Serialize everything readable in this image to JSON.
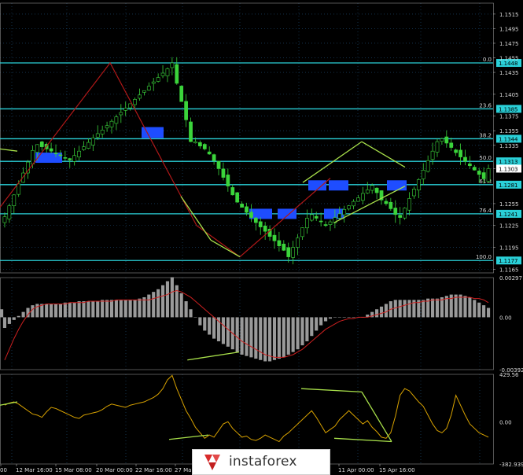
{
  "colors": {
    "background": "#000000",
    "grid": "#1f4f7a",
    "axis_text": "#d9d9d9",
    "candle": "#3bd43b",
    "fib_level": "#2ad0d8",
    "fib_label_bg": "#2ad0d8",
    "trend_line": "#a8e04a",
    "red_line": "#b01818",
    "zone": "#1e4dff",
    "histogram": "#9a9a9a",
    "signal": "#cc2020",
    "oscillator": "#d8a200"
  },
  "chart_data": [
    {
      "type": "candlestick",
      "name": "price",
      "ylim": [
        1.116,
        1.153
      ],
      "price_ticks": [
        "1.1515",
        "1.1495",
        "1.1475",
        "1.1455",
        "1.1435",
        "1.1405",
        "1.1375",
        "1.1355",
        "1.1335",
        "1.1303",
        "1.1255",
        "1.1225",
        "1.1195",
        "1.1165"
      ],
      "price_tick_values": [
        1.1515,
        1.1495,
        1.1475,
        1.1455,
        1.1435,
        1.1405,
        1.1375,
        1.1355,
        1.1335,
        1.1303,
        1.1255,
        1.1225,
        1.1195,
        1.1165
      ],
      "fib_levels": [
        {
          "label": "0.0",
          "price": "1.1448",
          "value": 1.1448
        },
        {
          "label": "23.6",
          "price": "1.1385",
          "value": 1.1385
        },
        {
          "label": "38.2",
          "price": "1.1344",
          "value": 1.1344
        },
        {
          "label": "50.0",
          "price": "1.1313",
          "value": 1.1313
        },
        {
          "label": "61.8",
          "price": "1.1281",
          "value": 1.1281
        },
        {
          "label": "76.4",
          "price": "1.1241",
          "value": 1.1241
        },
        {
          "label": "100.0",
          "price": "1.1177",
          "value": 1.1177
        }
      ],
      "current_price": "1.1303",
      "close_path": [
        1.1237,
        1.1252,
        1.1267,
        1.1282,
        1.1297,
        1.1312,
        1.1328,
        1.1336,
        1.1333,
        1.133,
        1.1327,
        1.1324,
        1.1321,
        1.1318,
        1.1315,
        1.1321,
        1.1327,
        1.1333,
        1.1339,
        1.1345,
        1.1351,
        1.1356,
        1.1362,
        1.1368,
        1.1374,
        1.138,
        1.1386,
        1.1392,
        1.1398,
        1.1404,
        1.141,
        1.1416,
        1.1422,
        1.1428,
        1.1434,
        1.144,
        1.1448,
        1.142,
        1.1395,
        1.137,
        1.134,
        1.134,
        1.1334,
        1.133,
        1.1323,
        1.1314,
        1.1303,
        1.1291,
        1.1279,
        1.1267,
        1.1257,
        1.125,
        1.1243,
        1.1236,
        1.1229,
        1.1223,
        1.1217,
        1.121,
        1.1204,
        1.1197,
        1.1191,
        1.1182,
        1.1195,
        1.1208,
        1.1222,
        1.1235,
        1.124,
        1.1235,
        1.123,
        1.1225,
        1.123,
        1.1236,
        1.1241,
        1.1247,
        1.1252,
        1.1258,
        1.1263,
        1.1269,
        1.1274,
        1.128,
        1.127,
        1.126,
        1.1255,
        1.1248,
        1.124,
        1.1236,
        1.1249,
        1.1262,
        1.1275,
        1.1288,
        1.1301,
        1.1314,
        1.1327,
        1.134,
        1.1344,
        1.1338,
        1.1332,
        1.1325,
        1.1319,
        1.1313,
        1.1307,
        1.1301,
        1.1295,
        1.1289,
        1.1303
      ]
    },
    {
      "type": "histogram",
      "name": "macd",
      "ylim": [
        -0.00392,
        0.00297
      ],
      "ticks": [
        "0.00297",
        "0.00",
        "-0.00392"
      ],
      "tick_values": [
        0.00297,
        0.0,
        -0.00392
      ],
      "values": [
        -0.0008,
        -0.0005,
        -0.0002,
        0.0001,
        0.0004,
        0.0007,
        0.0009,
        0.001,
        0.001,
        0.001,
        0.001,
        0.001,
        0.001,
        0.0011,
        0.0011,
        0.0011,
        0.0012,
        0.0012,
        0.0012,
        0.0012,
        0.0012,
        0.0013,
        0.0013,
        0.0013,
        0.0013,
        0.0013,
        0.0013,
        0.0013,
        0.0013,
        0.0014,
        0.0015,
        0.0017,
        0.0019,
        0.0021,
        0.0024,
        0.0027,
        0.003,
        0.0024,
        0.0018,
        0.0012,
        0.0006,
        0.0,
        -0.0006,
        -0.001,
        -0.0013,
        -0.0016,
        -0.0018,
        -0.002,
        -0.0022,
        -0.0024,
        -0.0026,
        -0.0028,
        -0.0029,
        -0.003,
        -0.0031,
        -0.0032,
        -0.0033,
        -0.0033,
        -0.0032,
        -0.0031,
        -0.003,
        -0.0028,
        -0.0026,
        -0.0024,
        -0.0021,
        -0.0018,
        -0.0014,
        -0.001,
        -0.0006,
        -0.0003,
        -0.0001,
        0.0,
        0.0,
        0.0,
        0.0,
        0.0,
        0.0,
        0.0,
        0.0002,
        0.0004,
        0.0006,
        0.0008,
        0.001,
        0.0012,
        0.0013,
        0.0013,
        0.0013,
        0.0013,
        0.0013,
        0.0013,
        0.0013,
        0.0014,
        0.0014,
        0.0014,
        0.0015,
        0.0016,
        0.0017,
        0.0017,
        0.0017,
        0.0016,
        0.0015,
        0.0013,
        0.0011,
        0.0009,
        0.0007,
        0.0006
      ],
      "signal": [
        -0.0032,
        -0.0024,
        -0.0016,
        -0.0009,
        -0.0003,
        0.0002,
        0.0006,
        0.0008,
        0.0009,
        0.001,
        0.001,
        0.001,
        0.001,
        0.001,
        0.0011,
        0.0011,
        0.0011,
        0.0011,
        0.0012,
        0.0012,
        0.0012,
        0.0012,
        0.0012,
        0.0012,
        0.0013,
        0.0013,
        0.0013,
        0.0013,
        0.0013,
        0.0013,
        0.0013,
        0.0013,
        0.0014,
        0.0015,
        0.0016,
        0.0017,
        0.0019,
        0.002,
        0.0019,
        0.0017,
        0.0015,
        0.0012,
        0.0009,
        0.0006,
        0.0003,
        0.0,
        -0.0003,
        -0.0006,
        -0.0009,
        -0.0012,
        -0.0015,
        -0.0018,
        -0.002,
        -0.0022,
        -0.0024,
        -0.0026,
        -0.0028,
        -0.0029,
        -0.003,
        -0.003,
        -0.003,
        -0.0029,
        -0.0028,
        -0.0026,
        -0.0024,
        -0.0021,
        -0.0018,
        -0.0015,
        -0.0012,
        -0.0009,
        -0.0007,
        -0.0005,
        -0.0003,
        -0.0002,
        -0.0001,
        -0.0001,
        0.0,
        0.0,
        0.0,
        0.0001,
        0.0002,
        0.0003,
        0.0004,
        0.0006,
        0.0007,
        0.0008,
        0.0009,
        0.001,
        0.0011,
        0.0011,
        0.0012,
        0.0012,
        0.0013,
        0.0013,
        0.0013,
        0.0014,
        0.0014,
        0.0015,
        0.0015,
        0.0015,
        0.0015,
        0.0014,
        0.0014,
        0.0013,
        0.0011
      ],
      "trend_line": [
        [
          0.38,
          -0.0032
        ],
        [
          0.485,
          -0.0026
        ]
      ]
    },
    {
      "type": "line",
      "name": "cci",
      "ylim": [
        -382.939,
        429.56
      ],
      "ticks": [
        "429.56",
        "0.00",
        "-382.939"
      ],
      "tick_values": [
        429.56,
        0.0,
        -382.939
      ],
      "values": [
        150,
        170,
        180,
        160,
        130,
        100,
        70,
        60,
        40,
        90,
        130,
        120,
        100,
        80,
        60,
        40,
        30,
        60,
        70,
        80,
        90,
        110,
        140,
        160,
        150,
        140,
        130,
        150,
        160,
        170,
        180,
        200,
        220,
        250,
        300,
        380,
        420,
        300,
        200,
        100,
        30,
        -50,
        -100,
        -150,
        -120,
        -140,
        -80,
        -20,
        0,
        -60,
        -100,
        -140,
        -130,
        -160,
        -170,
        -150,
        -120,
        -140,
        -160,
        -180,
        -130,
        -100,
        -60,
        -20,
        20,
        60,
        100,
        40,
        -30,
        -100,
        -70,
        -40,
        20,
        60,
        100,
        60,
        20,
        -20,
        10,
        -50,
        -90,
        -140,
        -150,
        -100,
        50,
        240,
        300,
        280,
        230,
        180,
        140,
        60,
        -20,
        -80,
        -100,
        -60,
        60,
        240,
        150,
        60,
        -20,
        -60,
        -100,
        -120,
        -140,
        -100,
        -30,
        40
      ]
    }
  ],
  "x_ticks": [
    "00",
    "12 Mar 16:00",
    "15 Mar 08:00",
    "20 Mar 00:00",
    "22 Mar 16:00",
    "27 Ma",
    "11 Apr 00:00",
    "15 Apr 16:00"
  ],
  "logo_text": "instaforex"
}
